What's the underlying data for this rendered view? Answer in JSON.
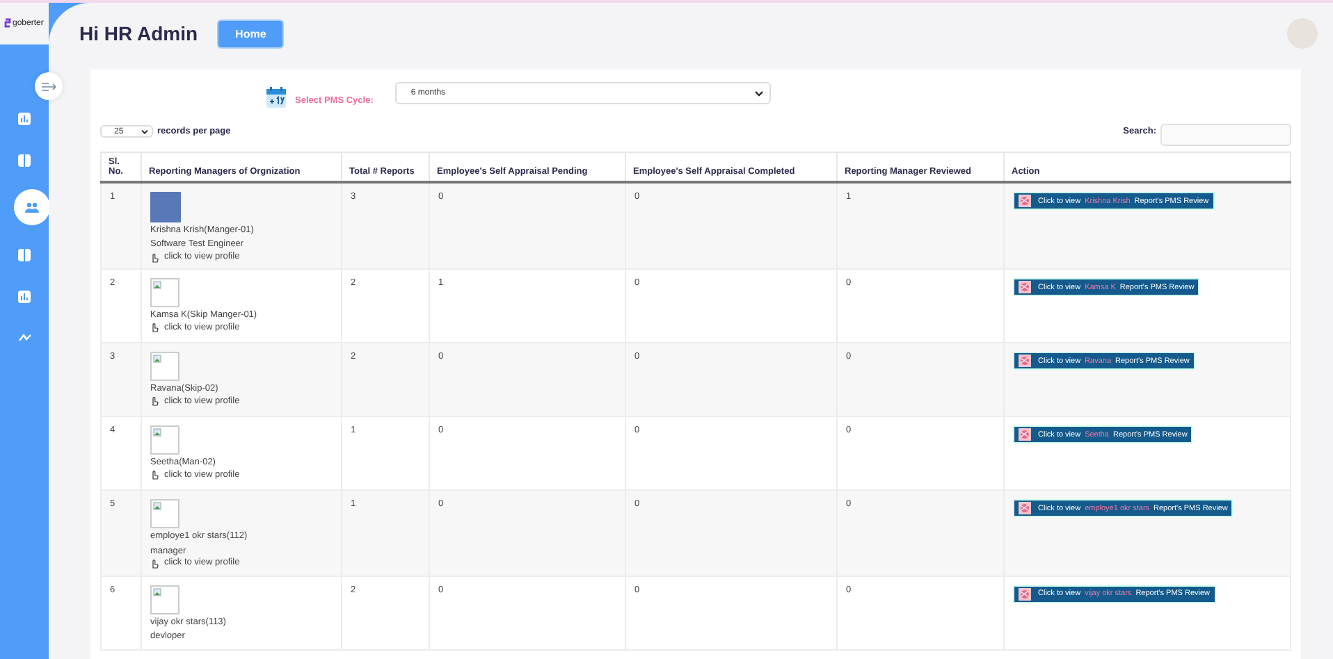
{
  "brand": {
    "name": "goberter"
  },
  "sidebar": {
    "items": [
      {
        "selected": false
      },
      {
        "selected": false
      },
      {
        "selected": true
      },
      {
        "selected": false
      },
      {
        "selected": false
      },
      {
        "selected": false
      }
    ]
  },
  "header": {
    "greeting": "Hi HR Admin",
    "home_button": "Home"
  },
  "pms_cycle": {
    "label": "Select PMS Cycle:",
    "value": "6 months"
  },
  "page_size": {
    "value": "25",
    "label": "records per page"
  },
  "search": {
    "label": "Search:"
  },
  "table": {
    "columns": [
      "Sl. No.",
      "Reporting Managers of Orgnization",
      "Total # Reports",
      "Employee's Self Appraisal Pending",
      "Employee's Self Appraisal Completed",
      "Reporting Manager Reviewed",
      "Action"
    ],
    "rows": [
      {
        "sl": "1",
        "photo": true,
        "name": "Krishna Krish(Manger-01)",
        "role": "Software Test Engineer",
        "profile_link": "click to view profile",
        "total": "3",
        "pending": "0",
        "completed": "0",
        "reviewed": "1",
        "action": {
          "prefix": "Click to view",
          "name": "Krishna Krish",
          "suffix": "Report's PMS Review"
        }
      },
      {
        "sl": "2",
        "photo": false,
        "name": "Kamsa K(Skip Manger-01)",
        "profile_link": "click to view profile",
        "total": "2",
        "pending": "1",
        "completed": "0",
        "reviewed": "0",
        "action": {
          "prefix": "Click to view",
          "name": "Kamsa K",
          "suffix": "Report's PMS Review"
        }
      },
      {
        "sl": "3",
        "photo": false,
        "name": "Ravana(Skip-02)",
        "profile_link": "click to view profile",
        "total": "2",
        "pending": "0",
        "completed": "0",
        "reviewed": "0",
        "action": {
          "prefix": "Click to view",
          "name": "Ravana",
          "suffix": "Report's PMS Review"
        }
      },
      {
        "sl": "4",
        "photo": false,
        "name": "Seetha(Man-02)",
        "profile_link": "click to view profile",
        "total": "1",
        "pending": "0",
        "completed": "0",
        "reviewed": "0",
        "action": {
          "prefix": "Click to view",
          "name": "Seetha",
          "suffix": "Report's PMS Review"
        }
      },
      {
        "sl": "5",
        "photo": false,
        "name": "employe1 okr stars(112)",
        "role": "manager",
        "profile_link": "click to view profile",
        "total": "1",
        "pending": "0",
        "completed": "0",
        "reviewed": "0",
        "action": {
          "prefix": "Click to view",
          "name": "employe1 okr stars",
          "suffix": "Report's PMS Review"
        }
      },
      {
        "sl": "6",
        "photo": false,
        "name": "vijay okr stars(113)",
        "role": "devloper",
        "total": "2",
        "pending": "0",
        "completed": "0",
        "reviewed": "0",
        "action": {
          "prefix": "Click to view",
          "name": "vijay okr stars",
          "suffix": "Report's PMS Review"
        }
      }
    ]
  }
}
